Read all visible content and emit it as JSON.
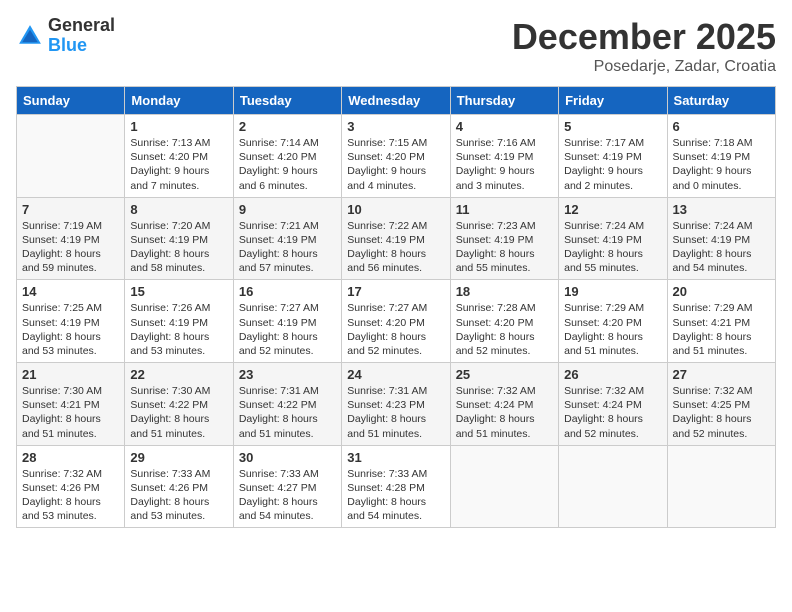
{
  "header": {
    "logo_general": "General",
    "logo_blue": "Blue",
    "month_title": "December 2025",
    "location": "Posedarje, Zadar, Croatia"
  },
  "weekdays": [
    "Sunday",
    "Monday",
    "Tuesday",
    "Wednesday",
    "Thursday",
    "Friday",
    "Saturday"
  ],
  "weeks": [
    [
      {
        "day": "",
        "info": ""
      },
      {
        "day": "1",
        "info": "Sunrise: 7:13 AM\nSunset: 4:20 PM\nDaylight: 9 hours\nand 7 minutes."
      },
      {
        "day": "2",
        "info": "Sunrise: 7:14 AM\nSunset: 4:20 PM\nDaylight: 9 hours\nand 6 minutes."
      },
      {
        "day": "3",
        "info": "Sunrise: 7:15 AM\nSunset: 4:20 PM\nDaylight: 9 hours\nand 4 minutes."
      },
      {
        "day": "4",
        "info": "Sunrise: 7:16 AM\nSunset: 4:19 PM\nDaylight: 9 hours\nand 3 minutes."
      },
      {
        "day": "5",
        "info": "Sunrise: 7:17 AM\nSunset: 4:19 PM\nDaylight: 9 hours\nand 2 minutes."
      },
      {
        "day": "6",
        "info": "Sunrise: 7:18 AM\nSunset: 4:19 PM\nDaylight: 9 hours\nand 0 minutes."
      }
    ],
    [
      {
        "day": "7",
        "info": "Sunrise: 7:19 AM\nSunset: 4:19 PM\nDaylight: 8 hours\nand 59 minutes."
      },
      {
        "day": "8",
        "info": "Sunrise: 7:20 AM\nSunset: 4:19 PM\nDaylight: 8 hours\nand 58 minutes."
      },
      {
        "day": "9",
        "info": "Sunrise: 7:21 AM\nSunset: 4:19 PM\nDaylight: 8 hours\nand 57 minutes."
      },
      {
        "day": "10",
        "info": "Sunrise: 7:22 AM\nSunset: 4:19 PM\nDaylight: 8 hours\nand 56 minutes."
      },
      {
        "day": "11",
        "info": "Sunrise: 7:23 AM\nSunset: 4:19 PM\nDaylight: 8 hours\nand 55 minutes."
      },
      {
        "day": "12",
        "info": "Sunrise: 7:24 AM\nSunset: 4:19 PM\nDaylight: 8 hours\nand 55 minutes."
      },
      {
        "day": "13",
        "info": "Sunrise: 7:24 AM\nSunset: 4:19 PM\nDaylight: 8 hours\nand 54 minutes."
      }
    ],
    [
      {
        "day": "14",
        "info": "Sunrise: 7:25 AM\nSunset: 4:19 PM\nDaylight: 8 hours\nand 53 minutes."
      },
      {
        "day": "15",
        "info": "Sunrise: 7:26 AM\nSunset: 4:19 PM\nDaylight: 8 hours\nand 53 minutes."
      },
      {
        "day": "16",
        "info": "Sunrise: 7:27 AM\nSunset: 4:19 PM\nDaylight: 8 hours\nand 52 minutes."
      },
      {
        "day": "17",
        "info": "Sunrise: 7:27 AM\nSunset: 4:20 PM\nDaylight: 8 hours\nand 52 minutes."
      },
      {
        "day": "18",
        "info": "Sunrise: 7:28 AM\nSunset: 4:20 PM\nDaylight: 8 hours\nand 52 minutes."
      },
      {
        "day": "19",
        "info": "Sunrise: 7:29 AM\nSunset: 4:20 PM\nDaylight: 8 hours\nand 51 minutes."
      },
      {
        "day": "20",
        "info": "Sunrise: 7:29 AM\nSunset: 4:21 PM\nDaylight: 8 hours\nand 51 minutes."
      }
    ],
    [
      {
        "day": "21",
        "info": "Sunrise: 7:30 AM\nSunset: 4:21 PM\nDaylight: 8 hours\nand 51 minutes."
      },
      {
        "day": "22",
        "info": "Sunrise: 7:30 AM\nSunset: 4:22 PM\nDaylight: 8 hours\nand 51 minutes."
      },
      {
        "day": "23",
        "info": "Sunrise: 7:31 AM\nSunset: 4:22 PM\nDaylight: 8 hours\nand 51 minutes."
      },
      {
        "day": "24",
        "info": "Sunrise: 7:31 AM\nSunset: 4:23 PM\nDaylight: 8 hours\nand 51 minutes."
      },
      {
        "day": "25",
        "info": "Sunrise: 7:32 AM\nSunset: 4:24 PM\nDaylight: 8 hours\nand 51 minutes."
      },
      {
        "day": "26",
        "info": "Sunrise: 7:32 AM\nSunset: 4:24 PM\nDaylight: 8 hours\nand 52 minutes."
      },
      {
        "day": "27",
        "info": "Sunrise: 7:32 AM\nSunset: 4:25 PM\nDaylight: 8 hours\nand 52 minutes."
      }
    ],
    [
      {
        "day": "28",
        "info": "Sunrise: 7:32 AM\nSunset: 4:26 PM\nDaylight: 8 hours\nand 53 minutes."
      },
      {
        "day": "29",
        "info": "Sunrise: 7:33 AM\nSunset: 4:26 PM\nDaylight: 8 hours\nand 53 minutes."
      },
      {
        "day": "30",
        "info": "Sunrise: 7:33 AM\nSunset: 4:27 PM\nDaylight: 8 hours\nand 54 minutes."
      },
      {
        "day": "31",
        "info": "Sunrise: 7:33 AM\nSunset: 4:28 PM\nDaylight: 8 hours\nand 54 minutes."
      },
      {
        "day": "",
        "info": ""
      },
      {
        "day": "",
        "info": ""
      },
      {
        "day": "",
        "info": ""
      }
    ]
  ]
}
